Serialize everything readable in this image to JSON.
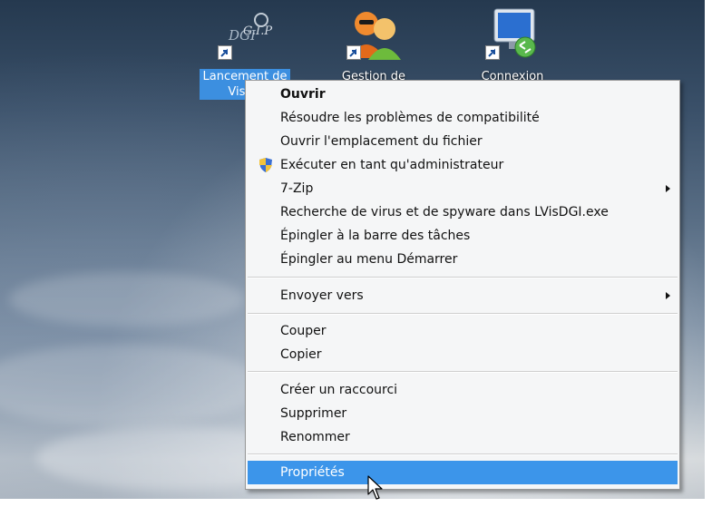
{
  "desktop": {
    "icons": [
      {
        "label_line1": "Lancement de",
        "label_line2": "VisuD",
        "selected": true
      },
      {
        "label_line1": "Gestion de",
        "label_line2": ""
      },
      {
        "label_line1": "Connexion",
        "label_line2": ""
      }
    ]
  },
  "menu": {
    "open": "Ouvrir",
    "troubleshoot": "Résoudre les problèmes de compatibilité",
    "open_location": "Ouvrir l'emplacement du fichier",
    "run_as_admin": "Exécuter en tant qu'administrateur",
    "seven_zip": "7-Zip",
    "virus_scan": "Recherche de virus et de spyware dans LVisDGI.exe",
    "pin_taskbar": "Épingler à la barre des tâches",
    "pin_start": "Épingler au menu Démarrer",
    "send_to": "Envoyer vers",
    "cut": "Couper",
    "copy": "Copier",
    "create_shortcut": "Créer un raccourci",
    "delete": "Supprimer",
    "rename": "Renommer",
    "properties": "Propriétés"
  },
  "colors": {
    "highlight": "#3c95ea",
    "selection": "#3c8fe0"
  }
}
